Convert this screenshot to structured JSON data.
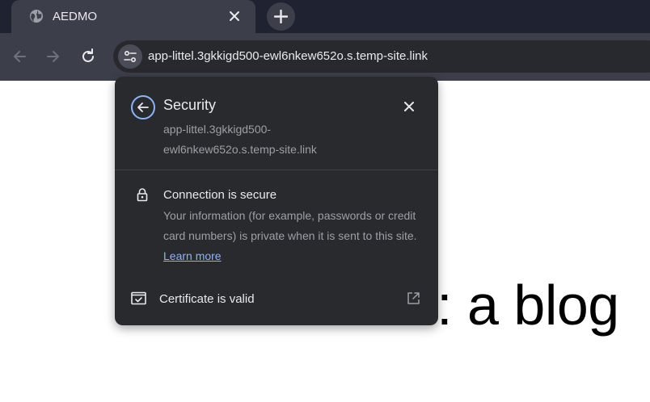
{
  "browser": {
    "tab": {
      "title": "AEDMO",
      "icon": "globe-icon"
    },
    "address_bar": {
      "url": "app-littel.3gkkigd500-ewl6nkew652o.s.temp-site.link"
    }
  },
  "page": {
    "heading": "mindblown: a blog"
  },
  "security_popup": {
    "title": "Security",
    "host": "app-littel.3gkkigd500-ewl6nkew652o.s.temp-site.link",
    "connection": {
      "title": "Connection is secure",
      "description": "Your information (for example, passwords or credit card numbers) is private when it is sent to this site.",
      "link": "Learn more"
    },
    "certificate": {
      "label": "Certificate is valid"
    }
  },
  "colors": {
    "tab_strip": "#1f2231",
    "toolbar": "#3c3f4a",
    "popup_bg": "#292a2d",
    "link": "#8ab4f8",
    "back_icon_ring": "#8ab4f8"
  }
}
